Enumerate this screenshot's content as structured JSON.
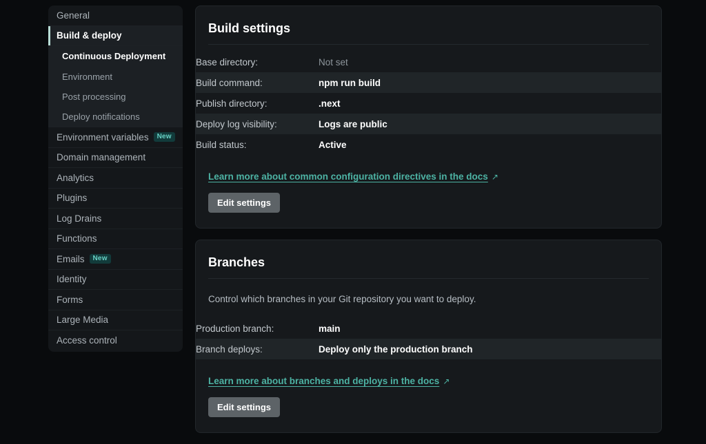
{
  "sidebar": {
    "items": [
      {
        "label": "General",
        "state": "normal",
        "badge": null
      },
      {
        "label": "Build & deploy",
        "state": "active",
        "badge": null
      },
      {
        "label": "Continuous Deployment",
        "state": "sub-current",
        "badge": null
      },
      {
        "label": "Environment",
        "state": "sub",
        "badge": null
      },
      {
        "label": "Post processing",
        "state": "sub",
        "badge": null
      },
      {
        "label": "Deploy notifications",
        "state": "sub-last",
        "badge": null
      },
      {
        "label": "Environment variables",
        "state": "normal",
        "badge": "New"
      },
      {
        "label": "Domain management",
        "state": "normal",
        "badge": null
      },
      {
        "label": "Analytics",
        "state": "normal",
        "badge": null
      },
      {
        "label": "Plugins",
        "state": "normal",
        "badge": null
      },
      {
        "label": "Log Drains",
        "state": "normal",
        "badge": null
      },
      {
        "label": "Functions",
        "state": "normal",
        "badge": null
      },
      {
        "label": "Emails",
        "state": "normal",
        "badge": "New"
      },
      {
        "label": "Identity",
        "state": "normal",
        "badge": null
      },
      {
        "label": "Forms",
        "state": "normal",
        "badge": null
      },
      {
        "label": "Large Media",
        "state": "normal",
        "badge": null
      },
      {
        "label": "Access control",
        "state": "normal",
        "badge": null
      }
    ]
  },
  "cards": [
    {
      "title": "Build settings",
      "description": null,
      "rows": [
        {
          "key": "Base directory:",
          "value": "Not set",
          "muted": true
        },
        {
          "key": "Build command:",
          "value": "npm run build",
          "muted": false
        },
        {
          "key": "Publish directory:",
          "value": ".next",
          "muted": false
        },
        {
          "key": "Deploy log visibility:",
          "value": "Logs are public",
          "muted": false
        },
        {
          "key": "Build status:",
          "value": "Active",
          "muted": false
        }
      ],
      "link": "Learn more about common configuration directives in the docs",
      "link_arrow": "↗",
      "button": "Edit settings"
    },
    {
      "title": "Branches",
      "description": "Control which branches in your Git repository you want to deploy.",
      "rows": [
        {
          "key": "Production branch:",
          "value": "main",
          "muted": false
        },
        {
          "key": "Branch deploys:",
          "value": "Deploy only the production branch",
          "muted": false
        }
      ],
      "link": "Learn more about branches and deploys in the docs",
      "link_arrow": "↗",
      "button": "Edit settings"
    }
  ],
  "colors": {
    "page_background": "#090b0d",
    "card_background": "#16191c",
    "row_stripe": "#202528",
    "accent_link": "#4db3a4",
    "active_indicator": "#b8ddd6",
    "badge_background": "#123b3b",
    "badge_text": "#67d0c4",
    "button_background": "#5d6367"
  }
}
